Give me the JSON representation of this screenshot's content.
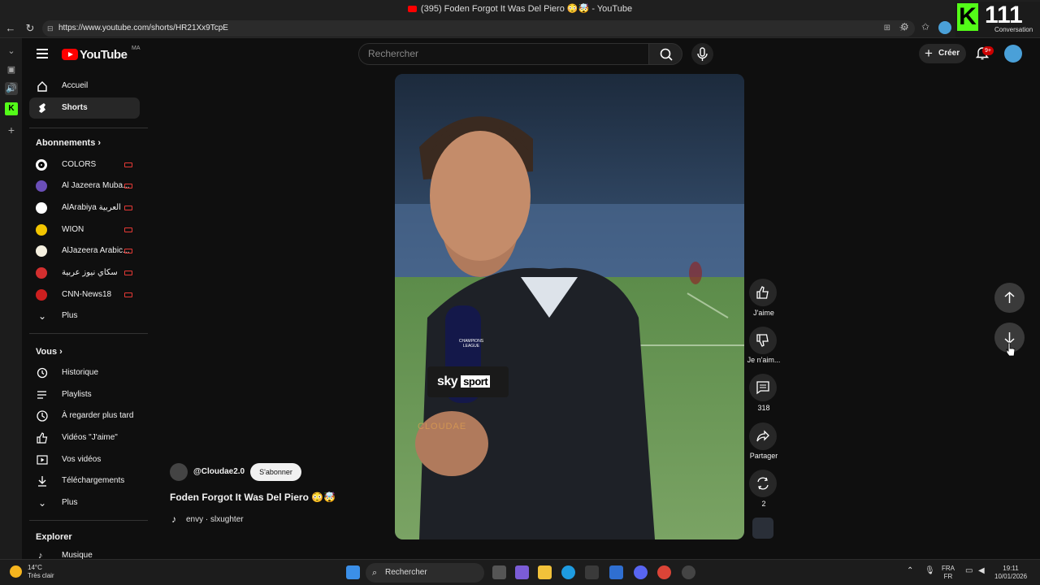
{
  "window": {
    "title": "(395) Foden Forgot It Was Del Piero 😳🤯 - YouTube"
  },
  "browser": {
    "url": "https://www.youtube.com/shorts/HR21Xx9TcpE"
  },
  "kick_overlay": {
    "letter": "K",
    "count": "111",
    "label": "Conversation"
  },
  "header": {
    "logo": "YouTube",
    "country_code": "MA",
    "search_placeholder": "Rechercher",
    "create_label": "Créer",
    "notifications_badge": "9+"
  },
  "sidebar": {
    "main": [
      {
        "label": "Accueil",
        "icon": "home-icon"
      },
      {
        "label": "Shorts",
        "icon": "shorts-icon",
        "active": true
      }
    ],
    "subscriptions_heading": "Abonnements",
    "subscriptions": [
      {
        "label": "COLORS",
        "color": "#ffffff"
      },
      {
        "label": "Al Jazeera Muba...",
        "color": "#6b4fb8"
      },
      {
        "label": "AlArabiya العربية",
        "color": "#ffffff"
      },
      {
        "label": "WION",
        "color": "#f2c500"
      },
      {
        "label": "AlJazeera Arabic...",
        "color": "#f5f0e0"
      },
      {
        "label": "سكاي نيوز عربية",
        "color": "#d32f2f"
      },
      {
        "label": "CNN-News18",
        "color": "#cc1f1f"
      }
    ],
    "subscriptions_more": "Plus",
    "you_heading": "Vous",
    "you": [
      {
        "label": "Historique",
        "icon": "history-icon"
      },
      {
        "label": "Playlists",
        "icon": "playlists-icon"
      },
      {
        "label": "À regarder plus tard",
        "icon": "watch-later-icon"
      },
      {
        "label": "Vidéos \"J'aime\"",
        "icon": "liked-videos-icon"
      },
      {
        "label": "Vos vidéos",
        "icon": "your-videos-icon"
      },
      {
        "label": "Téléchargements",
        "icon": "downloads-icon"
      }
    ],
    "you_more": "Plus",
    "explore_heading": "Explorer",
    "explore_first": "Musique"
  },
  "short": {
    "channel": "@Cloudae2.0",
    "subscribe_label": "S'abonner",
    "title": "Foden Forgot It Was Del Piero 😳🤯",
    "music": "envy · slxughter",
    "overlay_text": {
      "sky": "sky",
      "sport": "sport",
      "watermark": "CLOUDAE",
      "mic_label": "CHAMPIONS LEAGUE"
    }
  },
  "actions": {
    "like": "J'aime",
    "dislike": "Je n'aim...",
    "comments": "318",
    "share": "Partager",
    "remix": "2"
  },
  "taskbar": {
    "weather_temp": "14°C",
    "weather_desc": "Très clair",
    "search": "Rechercher",
    "lang_top": "FRA",
    "lang_bottom": "FR",
    "time": "19:11",
    "date": "10/01/2026"
  }
}
